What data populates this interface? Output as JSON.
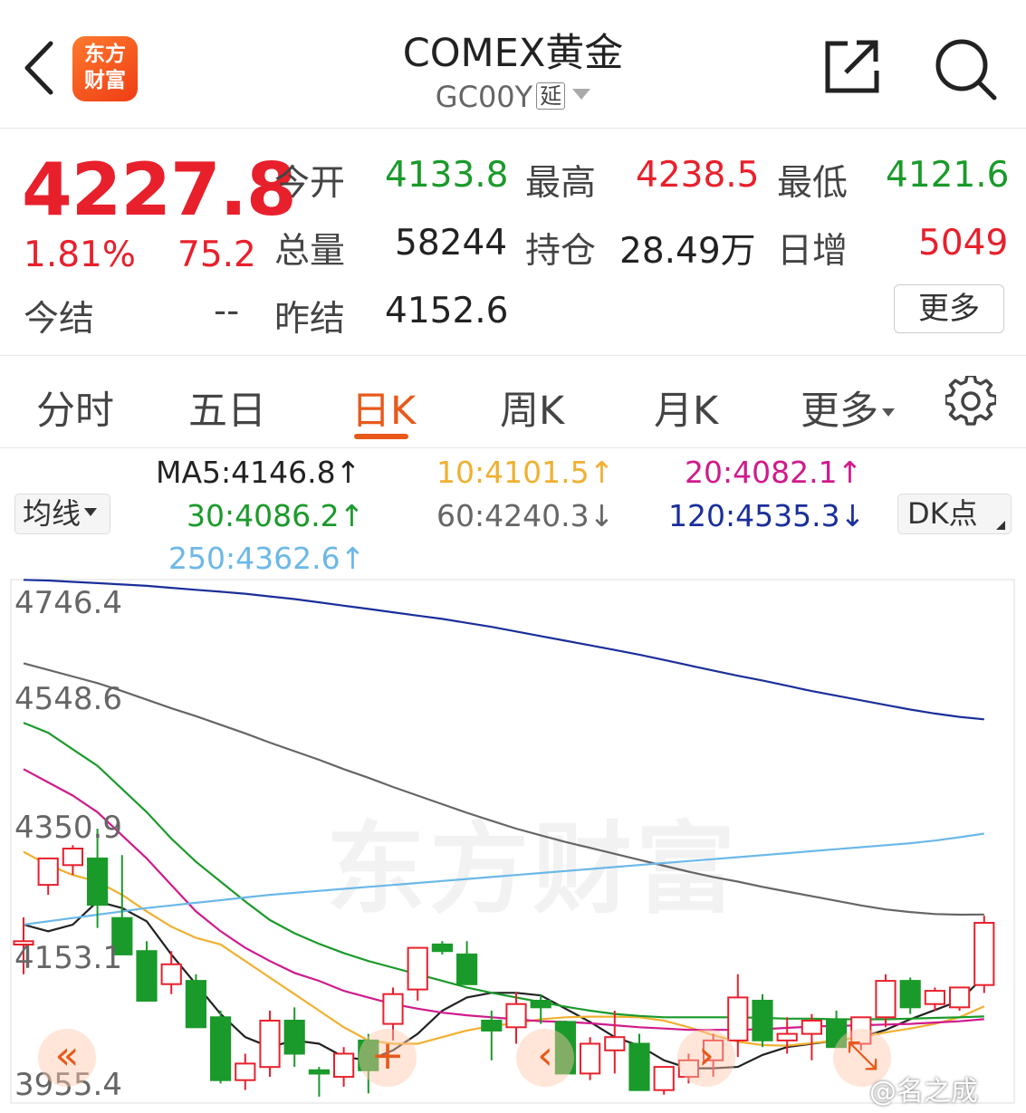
{
  "header": {
    "logo_text_top": "东方",
    "logo_text_bottom": "财富",
    "title": "COMEX黄金",
    "code": "GC00Y",
    "delay_badge": "延"
  },
  "quote": {
    "price": "4227.8",
    "change_pct": "1.81%",
    "change": "75.2",
    "settle_label": "今结",
    "settle_value": "--",
    "open_label": "今开",
    "open_value": "4133.8",
    "high_label": "最高",
    "high_value": "4238.5",
    "low_label": "最低",
    "low_value": "4121.6",
    "volume_label": "总量",
    "volume_value": "58244",
    "oi_label": "持仓",
    "oi_value": "28.49万",
    "daily_inc_label": "日增",
    "daily_inc_value": "5049",
    "prev_settle_label": "昨结",
    "prev_settle_value": "4152.6",
    "more_label": "更多"
  },
  "tabs": [
    {
      "label": "分时"
    },
    {
      "label": "五日"
    },
    {
      "label": "日K"
    },
    {
      "label": "周K"
    },
    {
      "label": "月K"
    },
    {
      "label": "更多"
    }
  ],
  "ma_legend": {
    "selector": "均线",
    "dk_button": "DK点",
    "ma5": "MA5:4146.8↑",
    "ma10": "10:4101.5↑",
    "ma20": "20:4082.1↑",
    "ma30": "30:4086.2↑",
    "ma60": "60:4240.3↓",
    "ma120": "120:4535.3↓",
    "ma250": "250:4362.6↑"
  },
  "colors": {
    "up": "#e8202c",
    "down": "#1a9a2a",
    "accent": "#e8591a",
    "ma5": "#222222",
    "ma10": "#f0b030",
    "ma20": "#d01a8c",
    "ma30": "#1a9a2a",
    "ma60": "#666666",
    "ma120": "#1a2f9a",
    "ma250": "#6bb8e8"
  },
  "chart_data": {
    "type": "candlestick",
    "ylim": [
      3955.4,
      4746.4
    ],
    "yticks": [
      "4746.4",
      "4548.6",
      "4350.9",
      "4153.1",
      "3955.4"
    ],
    "candles": [
      {
        "o": 4195,
        "h": 4236,
        "l": 4150,
        "c": 4200
      },
      {
        "o": 4285,
        "h": 4305,
        "l": 4270,
        "c": 4325
      },
      {
        "o": 4315,
        "h": 4345,
        "l": 4300,
        "c": 4340
      },
      {
        "o": 4325,
        "h": 4370,
        "l": 4220,
        "c": 4255
      },
      {
        "o": 4235,
        "h": 4330,
        "l": 4185,
        "c": 4180
      },
      {
        "o": 4185,
        "h": 4200,
        "l": 4140,
        "c": 4110
      },
      {
        "o": 4135,
        "h": 4185,
        "l": 4120,
        "c": 4165
      },
      {
        "o": 4140,
        "h": 4150,
        "l": 4070,
        "c": 4070
      },
      {
        "o": 4085,
        "h": 4095,
        "l": 3985,
        "c": 3990
      },
      {
        "o": 3990,
        "h": 4030,
        "l": 3975,
        "c": 4015
      },
      {
        "o": 4010,
        "h": 4095,
        "l": 3995,
        "c": 4080
      },
      {
        "o": 4080,
        "h": 4100,
        "l": 4010,
        "c": 4030
      },
      {
        "o": 4005,
        "h": 4010,
        "l": 3965,
        "c": 4000
      },
      {
        "o": 3995,
        "h": 4040,
        "l": 3980,
        "c": 4030
      },
      {
        "o": 4050,
        "h": 4060,
        "l": 3970,
        "c": 4005
      },
      {
        "o": 4075,
        "h": 4130,
        "l": 4050,
        "c": 4120
      },
      {
        "o": 4127,
        "h": 4180,
        "l": 4110,
        "c": 4190
      },
      {
        "o": 4195,
        "h": 4200,
        "l": 4180,
        "c": 4185
      },
      {
        "o": 4180,
        "h": 4200,
        "l": 4140,
        "c": 4135
      },
      {
        "o": 4080,
        "h": 4095,
        "l": 4020,
        "c": 4065
      },
      {
        "o": 4070,
        "h": 4123,
        "l": 4045,
        "c": 4105
      },
      {
        "o": 4110,
        "h": 4120,
        "l": 4075,
        "c": 4100
      },
      {
        "o": 4078,
        "h": 4080,
        "l": 4010,
        "c": 4000
      },
      {
        "o": 4000,
        "h": 4055,
        "l": 3990,
        "c": 4045
      },
      {
        "o": 4035,
        "h": 4095,
        "l": 4000,
        "c": 4055
      },
      {
        "o": 4045,
        "h": 4060,
        "l": 3975,
        "c": 3975
      },
      {
        "o": 3975,
        "h": 4010,
        "l": 3968,
        "c": 4010
      },
      {
        "o": 3995,
        "h": 4030,
        "l": 3985,
        "c": 4020
      },
      {
        "o": 4020,
        "h": 4060,
        "l": 3995,
        "c": 4050
      },
      {
        "o": 4050,
        "h": 4150,
        "l": 4025,
        "c": 4115
      },
      {
        "o": 4110,
        "h": 4120,
        "l": 4040,
        "c": 4050
      },
      {
        "o": 4050,
        "h": 4085,
        "l": 4030,
        "c": 4060
      },
      {
        "o": 4060,
        "h": 4090,
        "l": 4020,
        "c": 4080
      },
      {
        "o": 4080,
        "h": 4095,
        "l": 4045,
        "c": 4040
      },
      {
        "o": 4045,
        "h": 4085,
        "l": 4035,
        "c": 4085
      },
      {
        "o": 4085,
        "h": 4150,
        "l": 4070,
        "c": 4140
      },
      {
        "o": 4140,
        "h": 4145,
        "l": 4090,
        "c": 4100
      },
      {
        "o": 4105,
        "h": 4130,
        "l": 4095,
        "c": 4125
      },
      {
        "o": 4100,
        "h": 4130,
        "l": 4095,
        "c": 4130
      },
      {
        "o": 4133.8,
        "h": 4238.5,
        "l": 4121.6,
        "c": 4227.8
      }
    ],
    "ma_series": [
      {
        "name": "MA5",
        "values": [
          4225,
          4215,
          4225,
          4260,
          4250,
          4230,
          4180,
          4135,
          4090,
          4055,
          4040,
          4050,
          4045,
          4025,
          4020,
          4035,
          4060,
          4095,
          4115,
          4122,
          4122,
          4118,
          4098,
          4078,
          4055,
          4042,
          4020,
          4008,
          4008,
          4010,
          4028,
          4040,
          4045,
          4050,
          4055,
          4066,
          4082,
          4096,
          4110,
          4146.8
        ]
      },
      {
        "name": "10",
        "values": [
          4335,
          4315,
          4300,
          4290,
          4270,
          4245,
          4222,
          4205,
          4195,
          4170,
          4145,
          4120,
          4095,
          4070,
          4050,
          4045,
          4045,
          4055,
          4065,
          4072,
          4076,
          4082,
          4085,
          4086,
          4086,
          4085,
          4080,
          4070,
          4058,
          4048,
          4043,
          4042,
          4046,
          4050,
          4055,
          4062,
          4068,
          4075,
          4085,
          4101.5
        ]
      },
      {
        "name": "20",
        "values": [
          4460,
          4440,
          4420,
          4395,
          4360,
          4325,
          4285,
          4245,
          4215,
          4190,
          4170,
          4152,
          4140,
          4125,
          4115,
          4105,
          4098,
          4092,
          4088,
          4085,
          4082,
          4079,
          4078,
          4076,
          4073,
          4070,
          4068,
          4066,
          4066,
          4066,
          4067,
          4069,
          4071,
          4072,
          4073,
          4074,
          4075,
          4077,
          4079,
          4082.1
        ]
      },
      {
        "name": "30",
        "values": [
          4530,
          4515,
          4490,
          4465,
          4430,
          4395,
          4355,
          4320,
          4290,
          4260,
          4232,
          4212,
          4196,
          4182,
          4170,
          4160,
          4150,
          4140,
          4130,
          4122,
          4115,
          4108,
          4101,
          4095,
          4090,
          4087,
          4085,
          4085,
          4085,
          4085,
          4084,
          4083,
          4083,
          4082,
          4082,
          4082,
          4083,
          4084,
          4085,
          4086.2
        ]
      },
      {
        "name": "60",
        "values": [
          4620,
          4610,
          4600,
          4590,
          4578,
          4565,
          4552,
          4540,
          4527,
          4514,
          4500,
          4487,
          4474,
          4460,
          4447,
          4433,
          4420,
          4407,
          4394,
          4382,
          4370,
          4360,
          4350,
          4341,
          4332,
          4323,
          4314,
          4305,
          4297,
          4290,
          4282,
          4275,
          4268,
          4261,
          4254,
          4248,
          4244,
          4241,
          4240,
          4240.3
        ]
      },
      {
        "name": "120",
        "values": [
          4746,
          4745,
          4743,
          4741,
          4739,
          4737,
          4734,
          4731,
          4728,
          4725,
          4721,
          4717,
          4712,
          4707,
          4702,
          4697,
          4692,
          4687,
          4681,
          4675,
          4668,
          4661,
          4654,
          4647,
          4640,
          4633,
          4625,
          4617,
          4609,
          4601,
          4594,
          4586,
          4578,
          4571,
          4564,
          4557,
          4550,
          4544,
          4539,
          4535.3
        ]
      },
      {
        "name": "250",
        "values": [
          4225,
          4230,
          4235,
          4240,
          4245,
          4250,
          4254,
          4258,
          4262,
          4266,
          4270,
          4273,
          4276,
          4279,
          4282,
          4285,
          4288,
          4291,
          4294,
          4297,
          4300,
          4303,
          4306,
          4309,
          4312,
          4315,
          4318,
          4321,
          4324,
          4327,
          4330,
          4333,
          4336,
          4339,
          4342,
          4345,
          4348,
          4352,
          4357,
          4362.6
        ]
      }
    ]
  },
  "chart_watermark": "东方财富",
  "chart_buttons": {
    "prev": "«",
    "add": "+",
    "left": "‹",
    "right": "›",
    "shrink": "⤡"
  },
  "credit": "@名之成"
}
